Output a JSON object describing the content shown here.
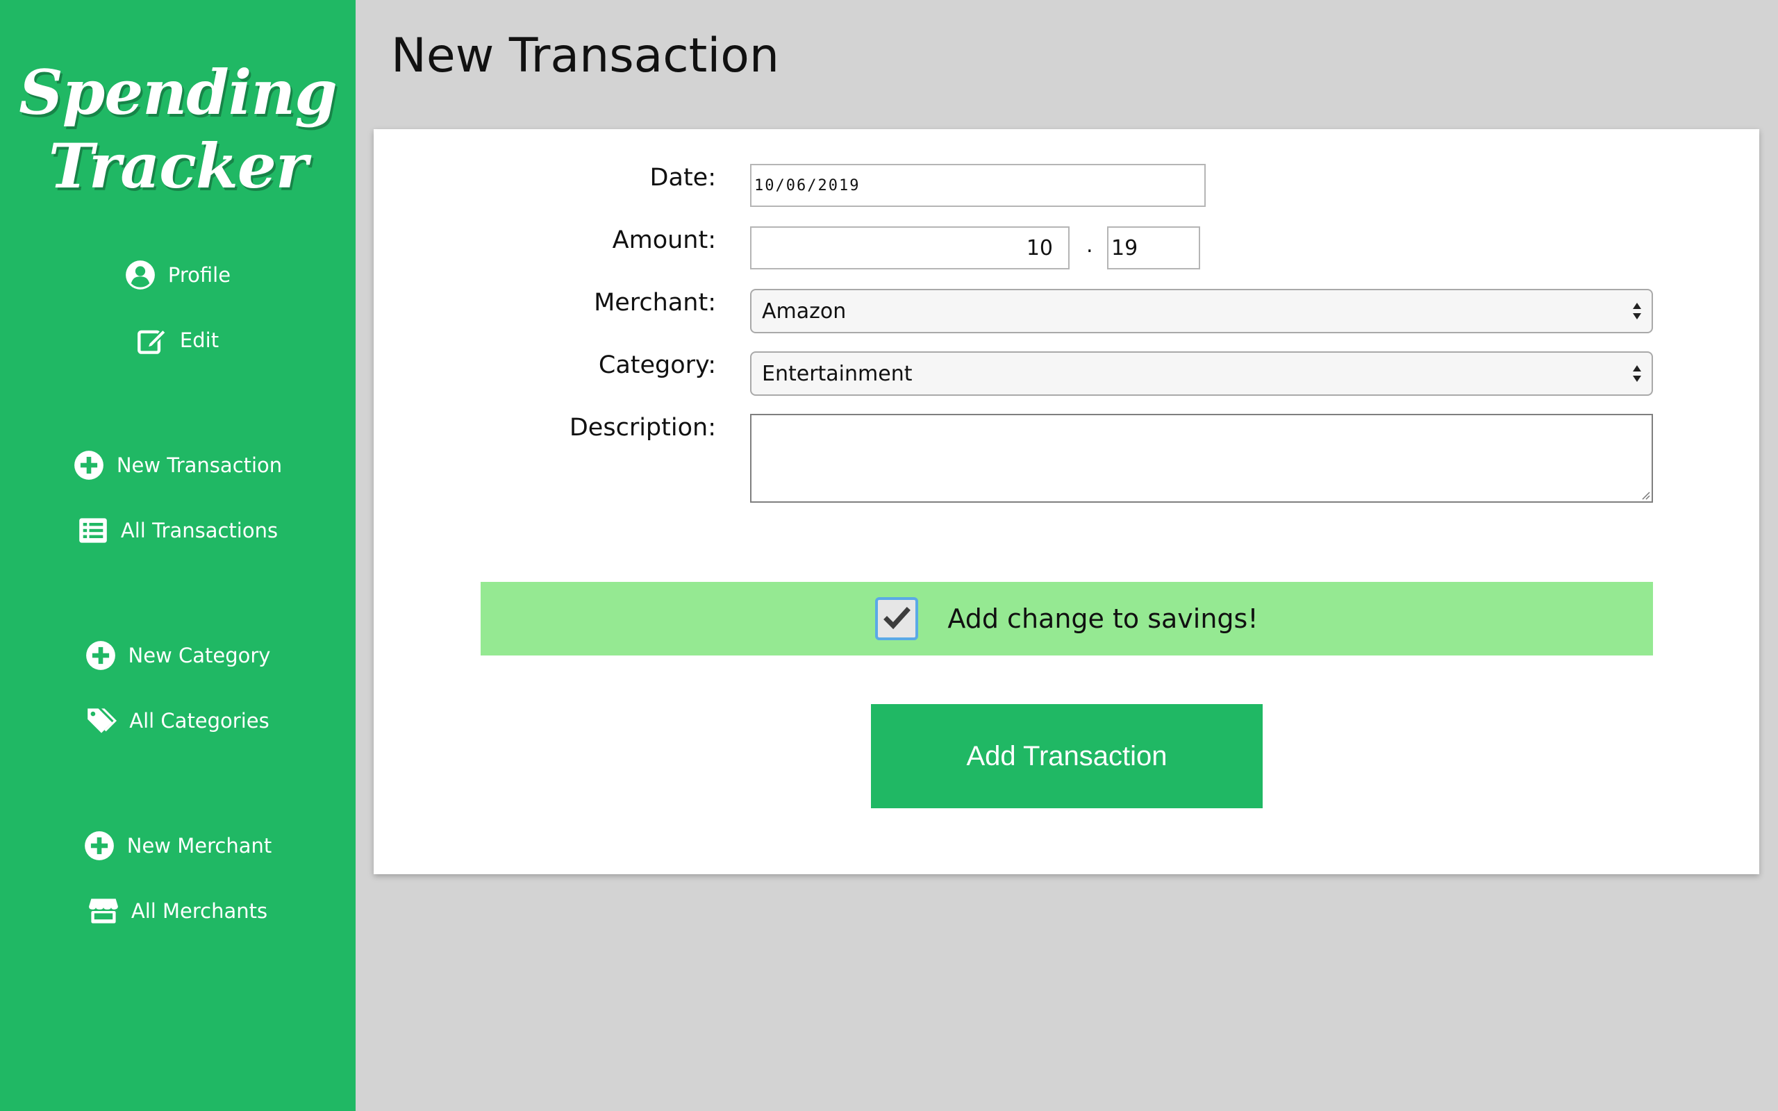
{
  "app": {
    "logo_line1": "Spending",
    "logo_line2": "Tracker",
    "accent_color": "#20b864",
    "savings_color": "#95e992"
  },
  "sidebar": {
    "items": [
      {
        "label": "Profile",
        "icon": "user-circle-icon"
      },
      {
        "label": "Edit",
        "icon": "edit-icon"
      },
      {
        "label": "New Transaction",
        "icon": "plus-circle-icon"
      },
      {
        "label": "All Transactions",
        "icon": "list-icon"
      },
      {
        "label": "New Category",
        "icon": "plus-circle-icon"
      },
      {
        "label": "All Categories",
        "icon": "tags-icon"
      },
      {
        "label": "New Merchant",
        "icon": "plus-circle-icon"
      },
      {
        "label": "All Merchants",
        "icon": "store-icon"
      }
    ]
  },
  "page": {
    "title": "New Transaction"
  },
  "form": {
    "date_label": "Date:",
    "date_value": "10/06/2019",
    "amount_label": "Amount:",
    "amount_int": "10",
    "amount_separator": ".",
    "amount_dec": "19",
    "merchant_label": "Merchant:",
    "merchant_value": "Amazon",
    "category_label": "Category:",
    "category_value": "Entertainment",
    "description_label": "Description:",
    "description_value": "",
    "savings_label": "Add change to savings!",
    "savings_checked": true,
    "submit_label": "Add Transaction"
  }
}
